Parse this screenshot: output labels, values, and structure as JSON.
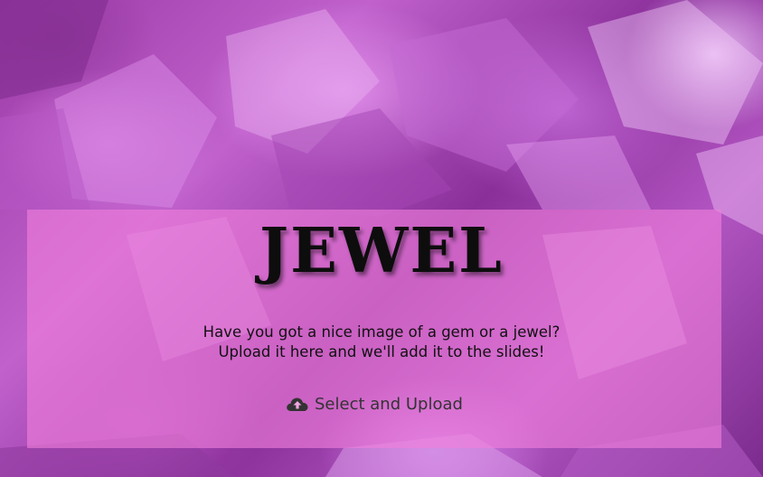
{
  "title": "JEWEL",
  "description": {
    "line1": "Have you got a nice image of a gem or a jewel?",
    "line2": "Upload it here and we'll add it to the slides!"
  },
  "upload": {
    "label": "Select and Upload",
    "icon": "cloud-upload-icon"
  },
  "colors": {
    "panel": "#f180dc",
    "title": "#0d0d0d",
    "background_accent": "#9b3aa6"
  }
}
